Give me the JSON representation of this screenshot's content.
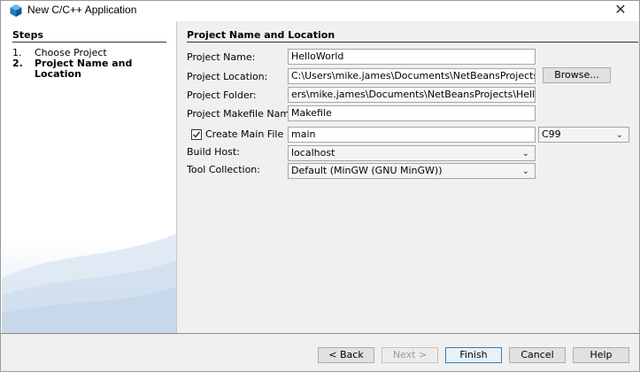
{
  "window": {
    "title": "New C/C++ Application",
    "close_icon": "✕"
  },
  "steps": {
    "heading": "Steps",
    "items": [
      {
        "num": "1.",
        "label": "Choose Project",
        "current": false
      },
      {
        "num": "2.",
        "label": "Project Name and Location",
        "current": true
      }
    ]
  },
  "main": {
    "heading": "Project Name and Location",
    "project_name": {
      "label": "Project Name:",
      "value": "HelloWorld"
    },
    "project_location": {
      "label": "Project Location:",
      "value": "C:\\Users\\mike.james\\Documents\\NetBeansProjects"
    },
    "browse_label": "Browse...",
    "project_folder": {
      "label": "Project Folder:",
      "value": "ers\\mike.james\\Documents\\NetBeansProjects\\HelloWorld"
    },
    "makefile_name": {
      "label": "Project Makefile Name:",
      "value": "Makefile"
    },
    "create_main_file": {
      "label": "Create Main File",
      "checked": true,
      "value": "main"
    },
    "language_standard": {
      "value": "C99"
    },
    "build_host": {
      "label": "Build Host:",
      "value": "localhost"
    },
    "tool_collection": {
      "label": "Tool Collection:",
      "value": "Default (MinGW (GNU MinGW))"
    }
  },
  "footer": {
    "back": "< Back",
    "next": "Next >",
    "finish": "Finish",
    "cancel": "Cancel",
    "help": "Help"
  },
  "colors": {
    "panel_bg": "#f0f0f0",
    "default_button_border": "#3c7fb1"
  }
}
